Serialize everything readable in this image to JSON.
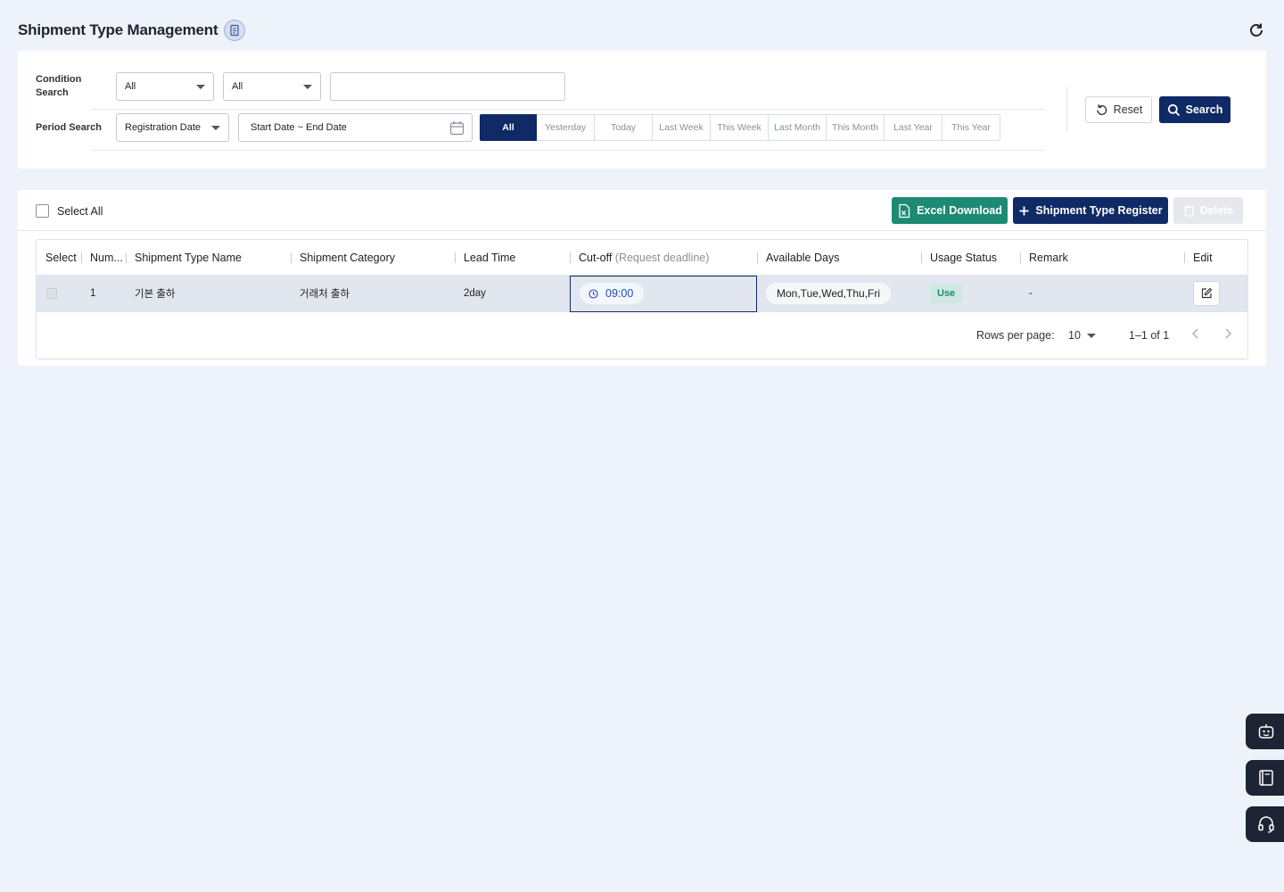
{
  "header": {
    "title": "Shipment Type Management"
  },
  "search": {
    "condition_label": "Condition Search",
    "condition_select_1": "All",
    "condition_select_2": "All",
    "keyword_value": "",
    "period_label": "Period Search",
    "period_type": "Registration Date",
    "date_range_placeholder": "Start Date ~ End Date",
    "period_buttons": [
      "All",
      "Yesterday",
      "Today",
      "Last Week",
      "This Week",
      "Last Month",
      "This Month",
      "Last Year",
      "This Year"
    ],
    "active_period": "All",
    "reset_label": "Reset",
    "search_label": "Search"
  },
  "toolbar": {
    "select_all_label": "Select All",
    "excel_label": "Excel Download",
    "register_label": "Shipment Type Register",
    "delete_label": "Delete"
  },
  "table": {
    "columns": {
      "select": "Select",
      "number": "Num...",
      "name": "Shipment Type Name",
      "category": "Shipment Category",
      "lead_time": "Lead Time",
      "cutoff": "Cut-off",
      "cutoff_sub": "(Request deadline)",
      "available_days": "Available Days",
      "usage_status": "Usage Status",
      "remark": "Remark",
      "edit": "Edit"
    },
    "rows": [
      {
        "number": "1",
        "name": "기본 출하",
        "category": "거래처 출하",
        "lead_time": "2day",
        "cutoff": "09:00",
        "available_days": "Mon,Tue,Wed,Thu,Fri",
        "usage_status": "Use",
        "remark": "-"
      }
    ]
  },
  "pagination": {
    "rows_per_page_label": "Rows per page:",
    "rows_per_page": "10",
    "range": "1–1 of 1"
  },
  "colors": {
    "primary": "#0f2a66",
    "excel": "#1d8a73",
    "background": "#eef3fb"
  },
  "floating_buttons": [
    "robot-icon",
    "book-icon",
    "headset-icon"
  ]
}
